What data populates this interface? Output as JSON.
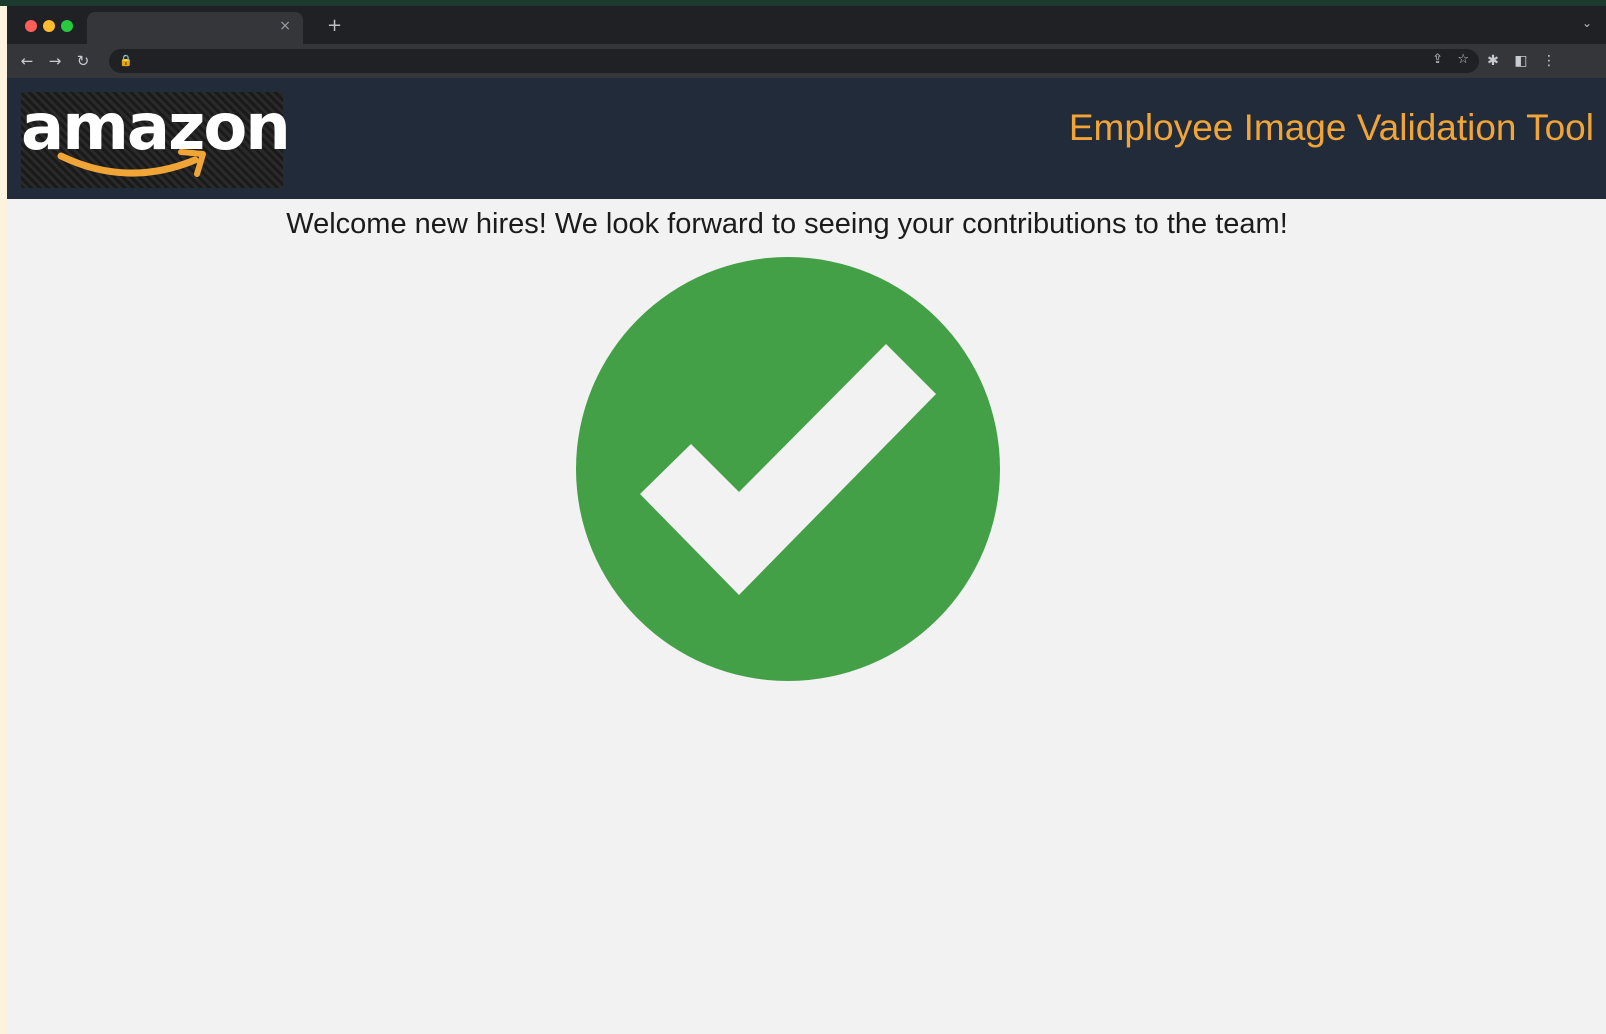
{
  "browser": {
    "tab_close": "×",
    "new_tab": "+",
    "tab_list": "⌄",
    "back": "←",
    "forward": "→",
    "reload": "↻",
    "lock": "🔒",
    "share": "⇪",
    "bookmark": "☆",
    "extensions": "✱",
    "sidepanel": "◧",
    "menu": "⋮"
  },
  "header": {
    "logo_text": "amazon",
    "title": "Employee Image Validation Tool"
  },
  "main": {
    "welcome": "Welcome new hires! We look forward to seeing your contributions to the team!"
  },
  "colors": {
    "header_bg": "#222b39",
    "title": "#f0a536",
    "check_green": "#43a047",
    "page_bg": "#f2f2f2"
  }
}
